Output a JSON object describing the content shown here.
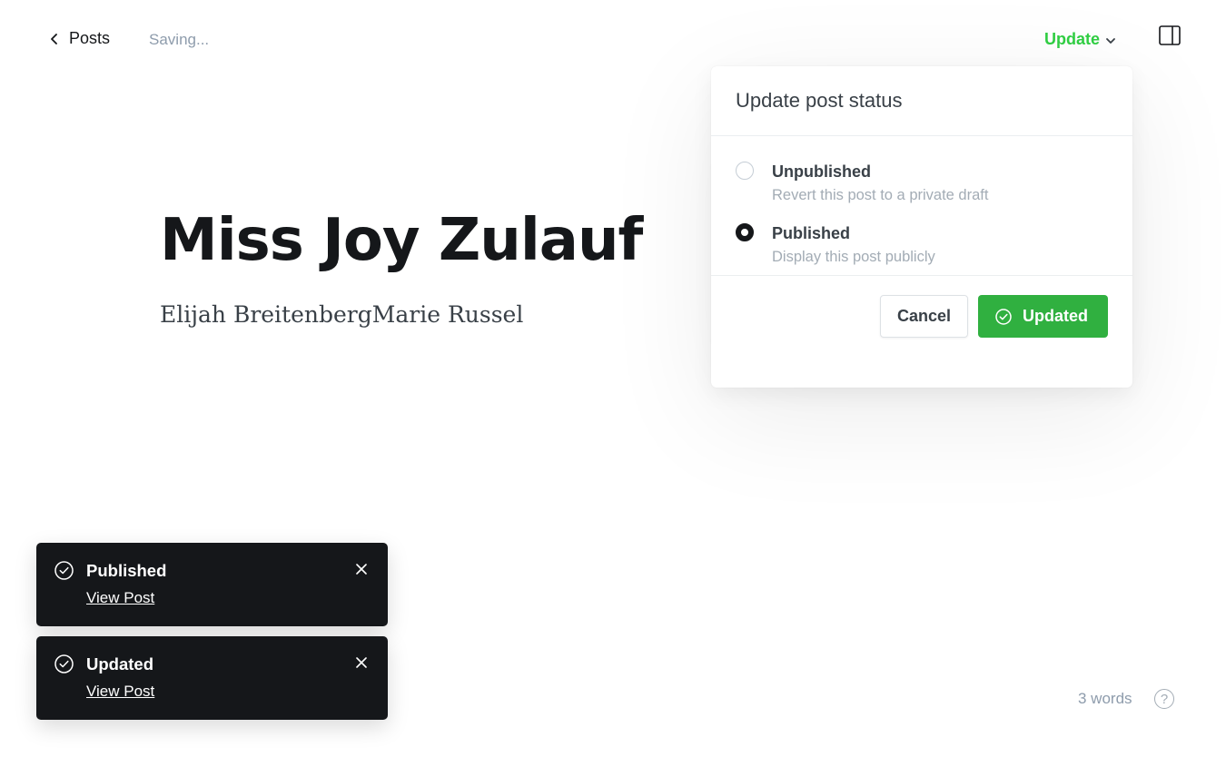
{
  "header": {
    "back_label": "Posts",
    "saving_status": "Saving...",
    "update_label": "Update"
  },
  "editor": {
    "title": "Miss Joy Zulauf",
    "body": "Elijah BreitenbergMarie Russel"
  },
  "popover": {
    "title": "Update post status",
    "options": [
      {
        "label": "Unpublished",
        "description": "Revert this post to a private draft",
        "selected": false
      },
      {
        "label": "Published",
        "description": "Display this post publicly",
        "selected": true
      }
    ],
    "cancel_label": "Cancel",
    "confirm_label": "Updated"
  },
  "toasts": [
    {
      "title": "Published",
      "link": "View Post"
    },
    {
      "title": "Updated",
      "link": "View Post"
    }
  ],
  "footer": {
    "word_count": "3 words",
    "help_glyph": "?"
  },
  "colors": {
    "accent_green": "#30cf43",
    "button_green": "#30b040",
    "toast_bg": "#15171a"
  },
  "icons": [
    "chevron-left-icon",
    "chevron-down-icon",
    "sidebar-toggle-icon",
    "check-circle-icon",
    "close-icon",
    "help-icon"
  ]
}
